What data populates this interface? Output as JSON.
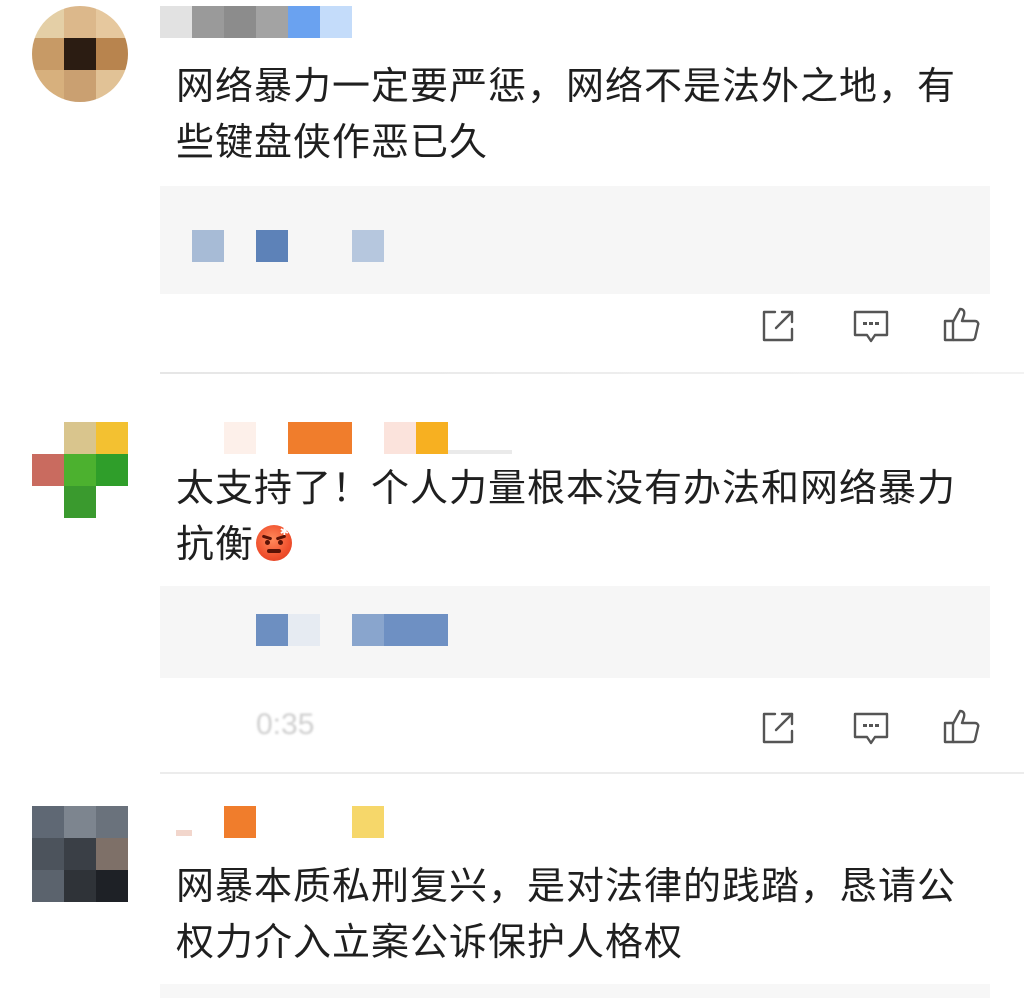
{
  "comments": [
    {
      "text": "网络暴力一定要严惩，网络不是法外之地，有些键盘侠作恶已久",
      "timestamp": ""
    },
    {
      "text": "太支持了！个人力量根本没有办法和网络暴力抗衡",
      "emoji": "angry-face-emoji",
      "timestamp": "0:35"
    },
    {
      "text": "网暴本质私刑复兴，是对法律的践踏，恳请公权力介入立案公诉保护人格权",
      "timestamp": ""
    }
  ],
  "icons": {
    "share": "share-icon",
    "comment": "comment-icon",
    "like": "like-icon"
  },
  "colors": {
    "text": "#1f1f1f",
    "icon": "#555555",
    "reply_panel": "#f6f6f6",
    "divider": "#ececec"
  }
}
